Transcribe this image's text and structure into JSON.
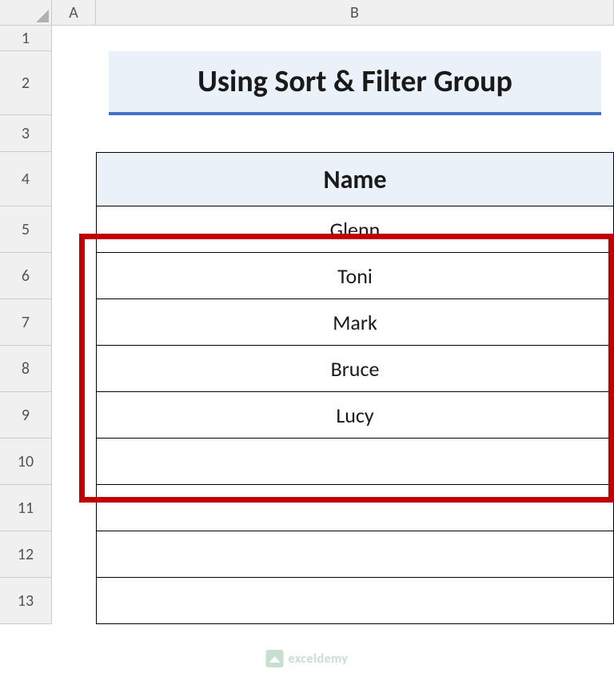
{
  "columns": {
    "A": "A",
    "B": "B"
  },
  "rows": [
    "1",
    "2",
    "3",
    "4",
    "5",
    "6",
    "7",
    "8",
    "9",
    "10",
    "11",
    "12",
    "13"
  ],
  "title": "Using Sort & Filter Group",
  "table": {
    "header": "Name",
    "data": [
      "Glenn",
      "Toni",
      "Mark",
      "Bruce",
      "Lucy",
      "",
      "",
      "",
      ""
    ]
  },
  "watermark": "exceldemy"
}
